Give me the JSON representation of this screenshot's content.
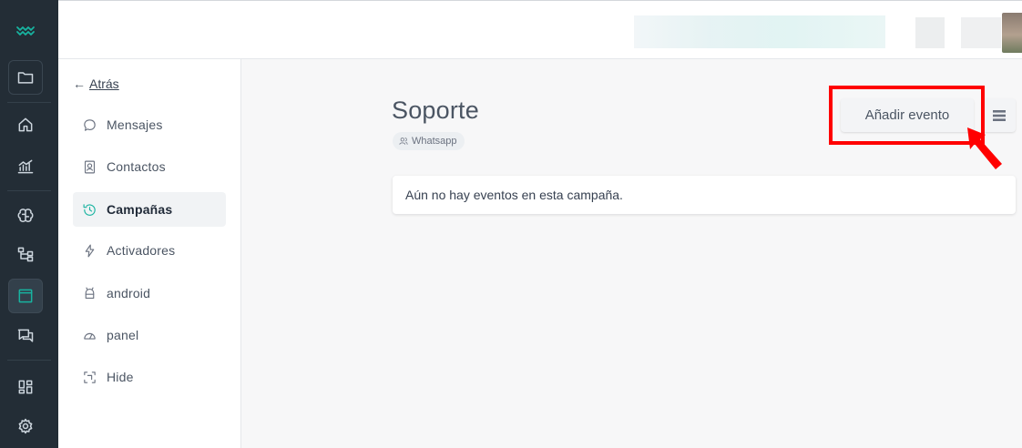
{
  "rail": {
    "items": [
      {
        "icon": "folder-icon"
      },
      {
        "icon": "home-icon"
      },
      {
        "icon": "analytics-icon"
      },
      {
        "icon": "brain-icon"
      },
      {
        "icon": "flow-icon"
      },
      {
        "icon": "window-icon"
      },
      {
        "icon": "chat-icon"
      },
      {
        "icon": "dashboard-icon"
      },
      {
        "icon": "gear-icon"
      }
    ],
    "accent": "#18b3a0"
  },
  "sidebar": {
    "back_arrow": "←",
    "back_label": "Atrás",
    "items": [
      {
        "label": "Mensajes",
        "icon": "message-icon"
      },
      {
        "label": "Contactos",
        "icon": "contacts-icon"
      },
      {
        "label": "Campañas",
        "icon": "history-icon",
        "active": true
      },
      {
        "label": "Activadores",
        "icon": "bolt-icon"
      },
      {
        "label": "android",
        "icon": "android-icon"
      },
      {
        "label": "panel",
        "icon": "gauge-icon"
      },
      {
        "label": "Hide",
        "icon": "frame-icon"
      }
    ]
  },
  "main": {
    "title": "Soporte",
    "channel_badge": "Whatsapp",
    "add_event_label": "Añadir evento",
    "empty_message": "Aún no hay eventos en esta campaña."
  },
  "annotation": {
    "highlight_color": "#ff0000"
  }
}
